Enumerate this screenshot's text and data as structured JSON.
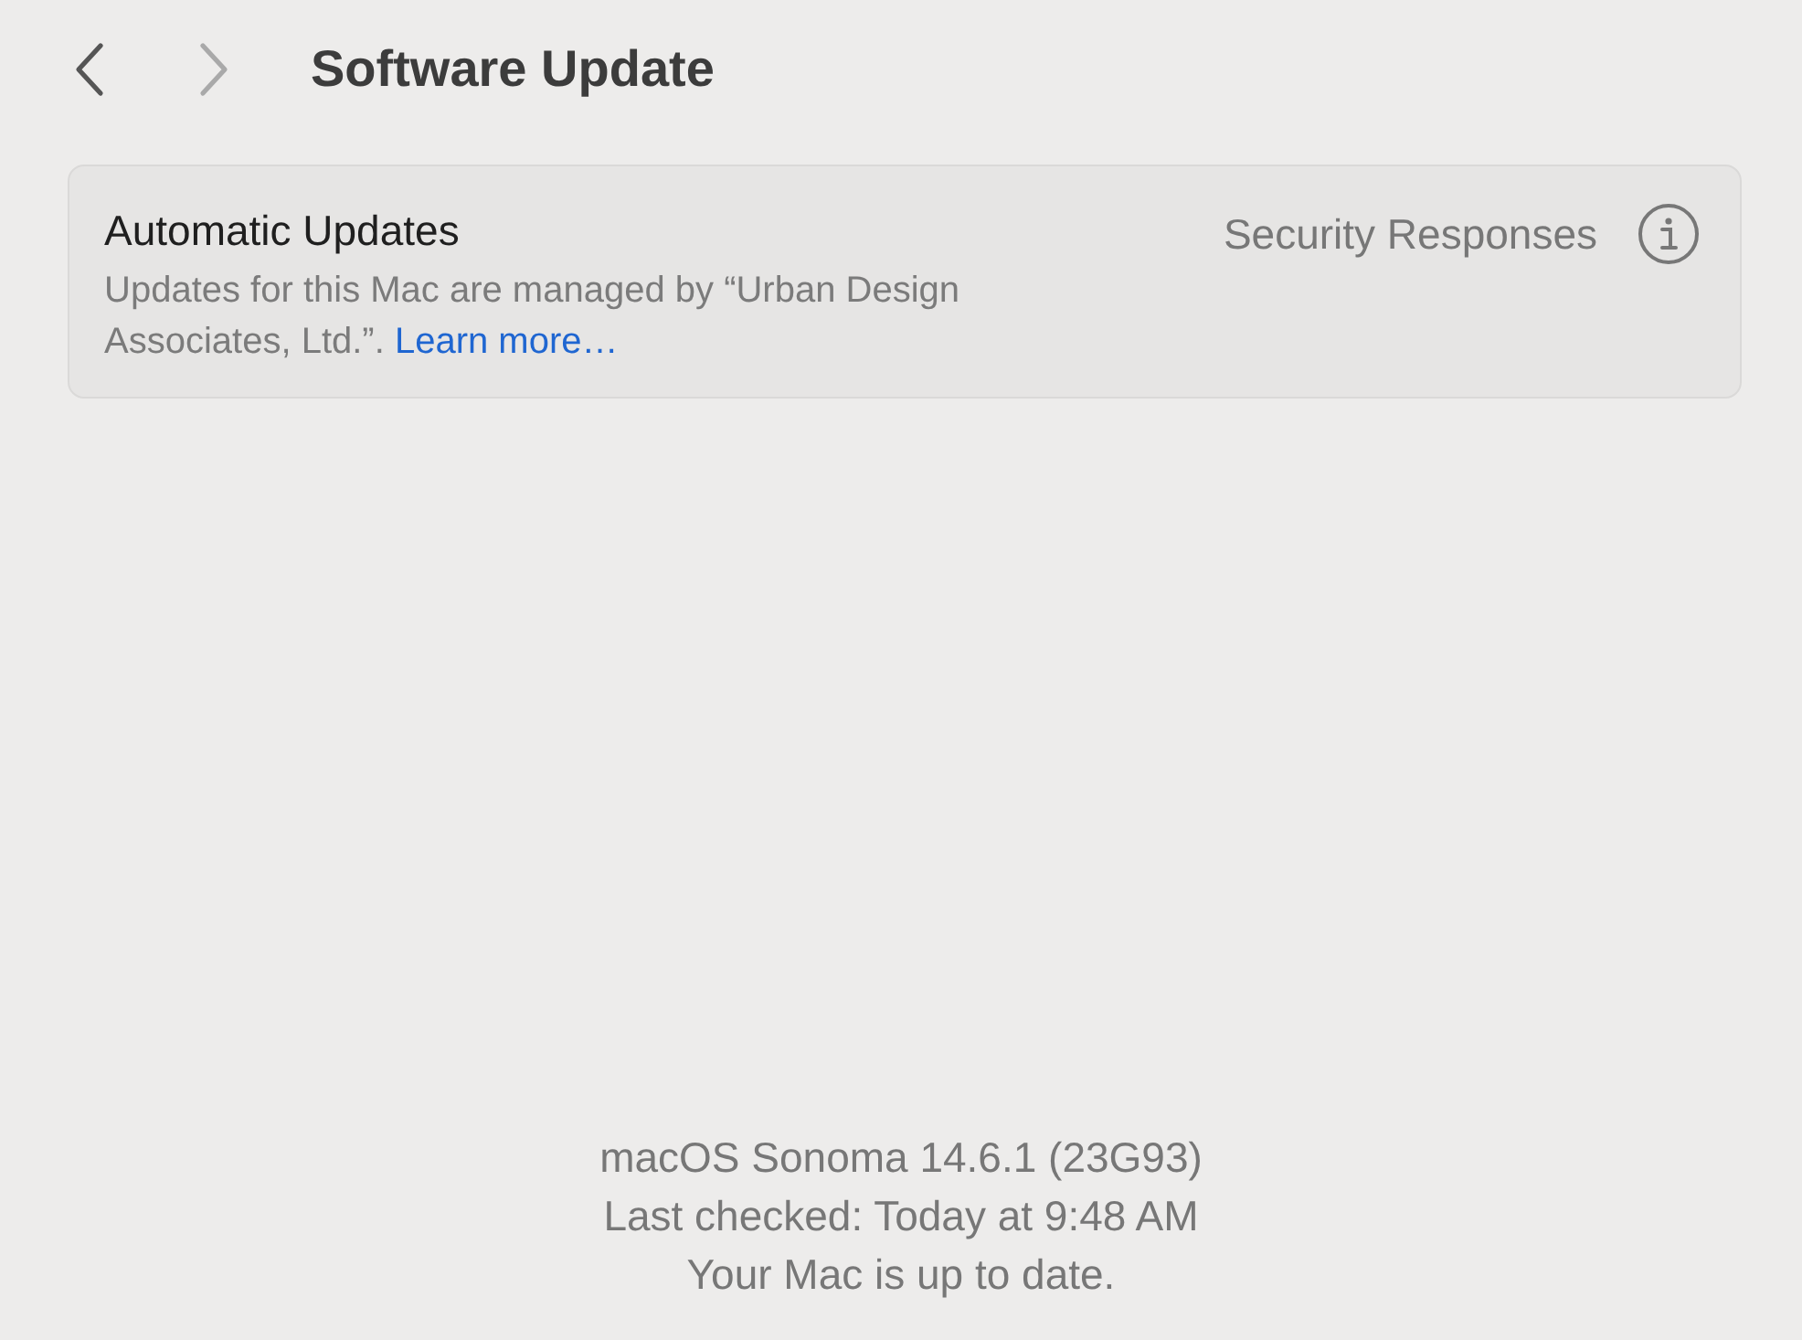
{
  "toolbar": {
    "nav": [
      {
        "kind": "back",
        "disabled": false
      },
      {
        "kind": "forward",
        "disabled": true
      }
    ],
    "title": "Software Update"
  },
  "automatic_updates": {
    "title": "Automatic Updates",
    "description": "Updates for this Mac are managed by “Urban Design Associates, Ltd.”.",
    "link": "Learn more…",
    "security_label": "Security Responses"
  },
  "status": [
    "macOS Sonoma 14.6.1 (23G93)",
    "Last checked: Today at 9:48 AM",
    "Your Mac is up to date."
  ]
}
